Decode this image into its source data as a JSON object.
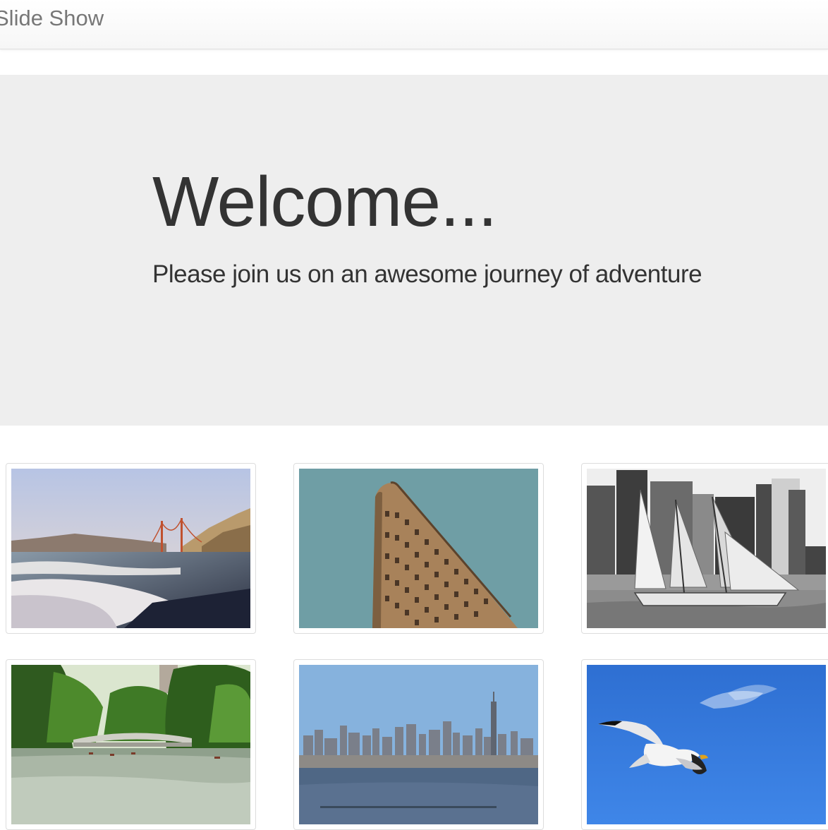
{
  "navbar": {
    "brand": "Slide Show"
  },
  "jumbotron": {
    "title": "Welcome...",
    "subtitle": "Please join us on an awesome journey of adventure"
  },
  "gallery": {
    "items": [
      {
        "icon": "golden-gate-beach-photo"
      },
      {
        "icon": "flatiron-building-photo"
      },
      {
        "icon": "sailboat-skyline-photo"
      },
      {
        "icon": "park-bridge-lake-photo"
      },
      {
        "icon": "city-skyline-photo"
      },
      {
        "icon": "seagull-sky-photo"
      }
    ]
  },
  "colors": {
    "jumbotron_bg": "#eeeeee",
    "text": "#333333",
    "brand": "#777777"
  }
}
